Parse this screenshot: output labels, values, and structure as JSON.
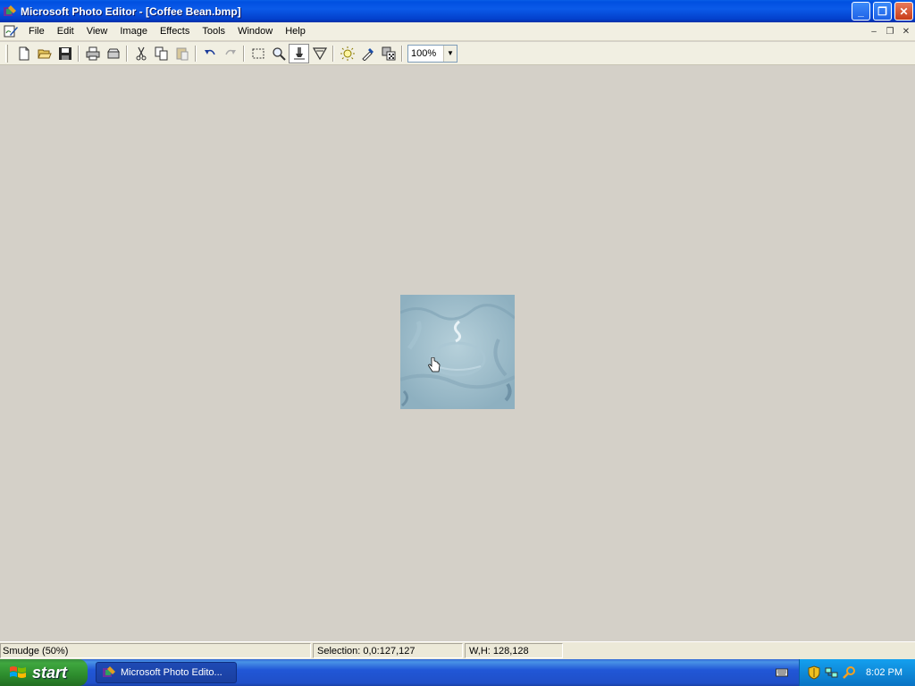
{
  "window": {
    "title": "Microsoft Photo Editor - [Coffee Bean.bmp]",
    "controls": {
      "minimize": "_",
      "maximize": "❐",
      "close": "✕"
    }
  },
  "menu": {
    "items": [
      "File",
      "Edit",
      "View",
      "Image",
      "Effects",
      "Tools",
      "Window",
      "Help"
    ]
  },
  "toolbar": {
    "buttons": [
      "new-icon",
      "open-icon",
      "save-icon",
      "print-icon",
      "scan-icon",
      "cut-icon",
      "copy-icon",
      "paste-icon",
      "undo-icon",
      "redo-icon",
      "select-icon",
      "zoom-icon",
      "smudge-icon",
      "sharpen-icon",
      "balance-icon",
      "eyedropper-icon",
      "transparency-icon"
    ],
    "zoom_value": "100%"
  },
  "status": {
    "tool": "Smudge (50%)",
    "selection": "Selection: 0,0:127,127",
    "size": "W,H: 128,128"
  },
  "taskbar": {
    "start_label": "start",
    "task_label": "Microsoft Photo Edito...",
    "clock": "8:02 PM"
  },
  "colors": {
    "title_blue": "#0050e0",
    "start_green": "#3fa73f",
    "image_tint": "#9fbecc"
  }
}
